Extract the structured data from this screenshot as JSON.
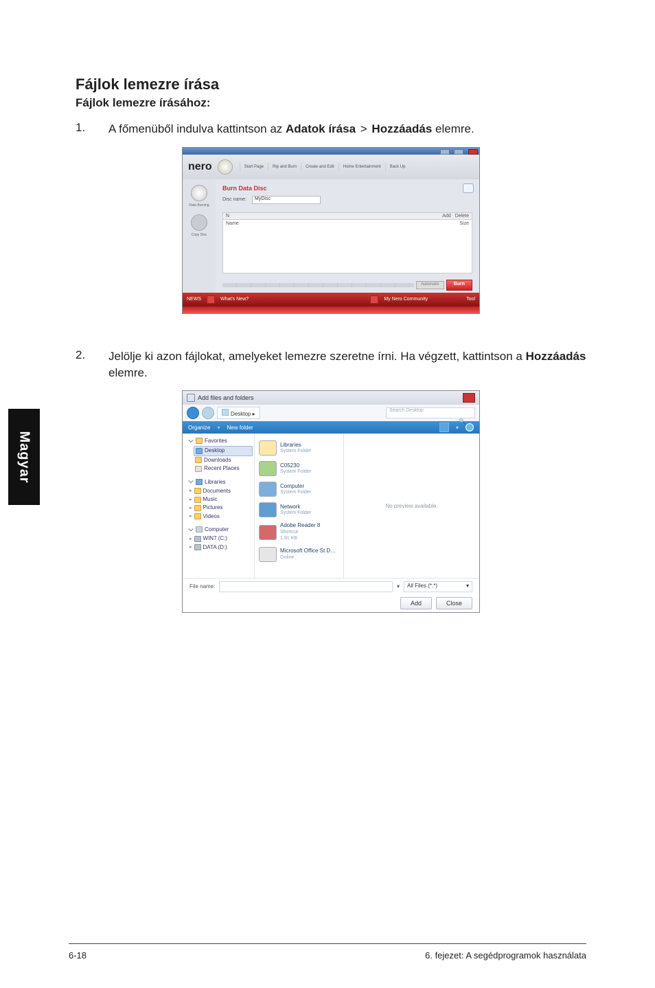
{
  "doc": {
    "title": "Fájlok lemezre írása",
    "subtitle": "Fájlok lemezre írásához:",
    "step1_num": "1.",
    "step1_pre": "A főmenüből indulva kattintson az ",
    "step1_b1": "Adatok írása",
    "step1_gt": " > ",
    "step1_b2": "Hozzáadás",
    "step1_post": " elemre.",
    "step2_num": "2.",
    "step2_pre": "Jelölje ki azon fájlokat, amelyeket lemezre szeretne írni. Ha végzett, kattintson a ",
    "step2_b1": "Hozzáadás",
    "step2_post": " elemre."
  },
  "nero": {
    "logo": "nero",
    "tabs": [
      "Start Page",
      "Rip and Burn",
      "Create and Edit",
      "Home Entertainment",
      "Back Up"
    ],
    "side_label1": "Data Burning",
    "side_label2": "Copy Disc",
    "main_title": "Burn Data Disc",
    "disc_name_label": "Disc name:",
    "disc_name_value": "MyDisc",
    "list_head_left": "N",
    "list_head_add": "Add",
    "list_head_del": "Delete",
    "list_name": "Name",
    "list_size": "Size",
    "auto": "Automatic",
    "burn": "Burn",
    "news": "NEWS",
    "whats": "What's New?",
    "community": "My Nero Community",
    "tool": "Tool"
  },
  "dlg": {
    "title": "Add files and folders",
    "path_desktop": "Desktop",
    "search_placeholder": "Search Desktop",
    "organize": "Organize",
    "newfolder": "New folder",
    "nav_fav": "Favorites",
    "nav_desktop": "Desktop",
    "nav_downloads": "Downloads",
    "nav_recent": "Recent Places",
    "nav_lib": "Libraries",
    "nav_docs": "Documents",
    "nav_music": "Music",
    "nav_pics": "Pictures",
    "nav_videos": "Videos",
    "nav_computer": "Computer",
    "nav_win7": "WIN7 (C:)",
    "nav_data": "DATA (D:)",
    "list_libraries": "Libraries",
    "list_sysfolder": "System Folder",
    "list_user": "C05230",
    "list_computer": "Computer",
    "list_network": "Network",
    "list_ar": "Adobe Reader 8",
    "list_ar_sub": "Shortcut",
    "list_ar_size": "1.91 KB",
    "list_ms": "Microsoft Office St D…",
    "list_ms_sub": "Online",
    "preview": "No preview available.",
    "filename_label": "File name:",
    "filter": "All Files (*.*)",
    "add": "Add",
    "cancel": "Close"
  },
  "sidetab": "Magyar",
  "footer_left": "6-18",
  "footer_right": "6. fejezet: A segédprogramok használata"
}
